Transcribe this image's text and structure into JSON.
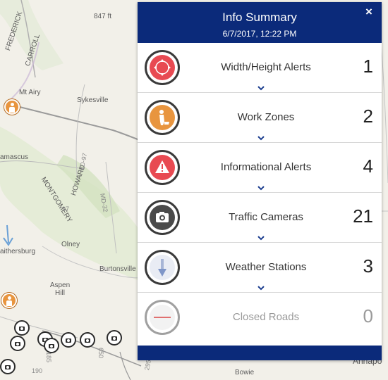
{
  "map": {
    "labels": {
      "elevation": "847 ft",
      "frederick": "FREDERICK",
      "carroll": "CARROLL",
      "mt_airy": "Mt Airy",
      "sykesville": "Sykesville",
      "damascus": "amascus",
      "howard": "HOWARD",
      "montgomery": "MONTGOMERY",
      "md97": "MD-97",
      "md32": "MD-32",
      "olney": "Olney",
      "gaithersburg": "aithersburg",
      "burtonsville": "Burtonsville",
      "aspen_hill": "Aspen Hill",
      "bowie": "Bowie",
      "annapolis": "Annapo",
      "r97": "97",
      "r185": "185",
      "r650": "650",
      "r190": "190",
      "r295": "295"
    }
  },
  "panel": {
    "title": "Info Summary",
    "date": "6/7/2017, 12:22 PM",
    "close_label": "×",
    "rows": [
      {
        "label": "Width/Height Alerts",
        "count": "1",
        "icon": "width-height-alert-icon",
        "color": "#e84a52"
      },
      {
        "label": "Work Zones",
        "count": "2",
        "icon": "work-zone-icon",
        "color": "#e8953f"
      },
      {
        "label": "Informational Alerts",
        "count": "4",
        "icon": "info-alert-icon",
        "color": "#e84a52"
      },
      {
        "label": "Traffic Cameras",
        "count": "21",
        "icon": "camera-icon",
        "color": "#4a4a4a"
      },
      {
        "label": "Weather Stations",
        "count": "3",
        "icon": "weather-station-icon",
        "color": "#c9cfe0"
      },
      {
        "label": "Closed Roads",
        "count": "0",
        "icon": "closed-road-icon",
        "color": "#e07070"
      }
    ]
  },
  "colors": {
    "header": "#0b2a7a",
    "alert_red": "#e84a52",
    "work_orange": "#e8953f"
  }
}
